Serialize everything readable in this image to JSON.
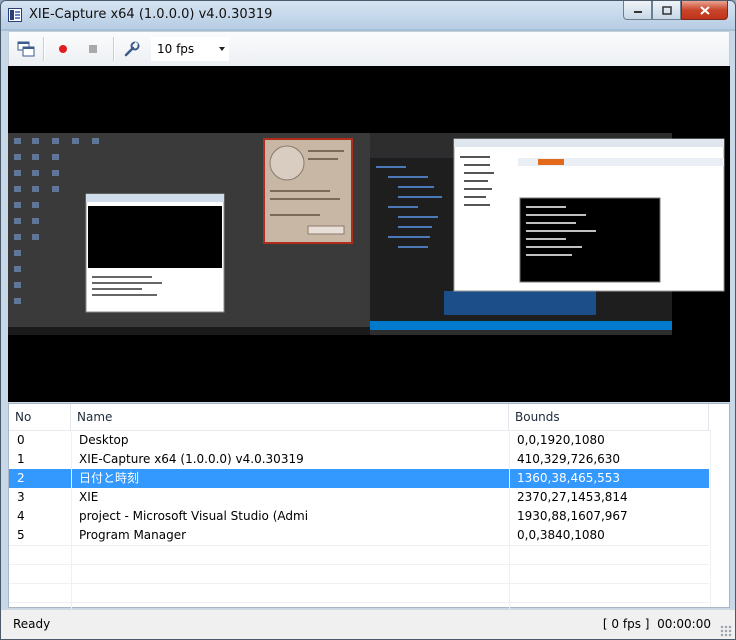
{
  "window": {
    "title": "XIE-Capture x64 (1.0.0.0) v4.0.30319",
    "controls": [
      "minimize-icon",
      "maximize-icon",
      "close-icon"
    ]
  },
  "toolbar": {
    "icons": [
      "windows-icon",
      "record-icon",
      "stop-icon",
      "wrench-icon"
    ],
    "fps_value": "10 fps",
    "record_color": "#e02020"
  },
  "list": {
    "columns": [
      "No",
      "Name",
      "Bounds"
    ],
    "rows": [
      {
        "no": "0",
        "name": "Desktop",
        "bounds": "0,0,1920,1080"
      },
      {
        "no": "1",
        "name": "XIE-Capture x64 (1.0.0.0) v4.0.30319",
        "bounds": "410,329,726,630"
      },
      {
        "no": "2",
        "name": "日付と時刻",
        "bounds": "1360,38,465,553"
      },
      {
        "no": "3",
        "name": "XIE",
        "bounds": "2370,27,1453,814"
      },
      {
        "no": "4",
        "name": "project - Microsoft Visual Studio (Admi",
        "bounds": "1930,88,1607,967"
      },
      {
        "no": "5",
        "name": "Program Manager",
        "bounds": "0,0,3840,1080"
      }
    ],
    "selected_index": 2,
    "selection_color": "#3399ff"
  },
  "status": {
    "text": "Ready",
    "fps": "[ 0 fps ]",
    "time": "00:00:00"
  }
}
